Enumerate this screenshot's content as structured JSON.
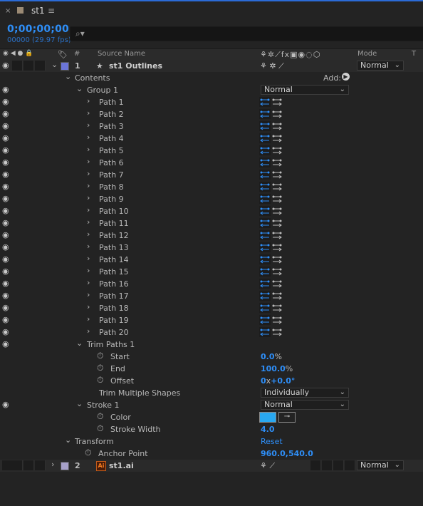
{
  "tab": {
    "title": "st1",
    "close_icon": "×",
    "menu_icon": "≡"
  },
  "timecode": "0;00;00;00",
  "frames": "00000 (29.97 fps)",
  "search": {
    "icon": "⌕▾",
    "placeholder": ""
  },
  "header": {
    "hash": "#",
    "tag_icon": "🏷",
    "source_name": "Source Name",
    "mode": "Mode",
    "t": "T",
    "switch_glyphs": "⚘✲⟋fx▣◉◌⬡",
    "vis_glyphs": "◉ ◀ ● 🔒"
  },
  "layer1": {
    "num": "1",
    "star": "★",
    "name": "st1 Outlines",
    "color": "#6b75d8",
    "mode": "Normal",
    "switches": "⚘ ✲ ⟋"
  },
  "contents": {
    "label": "Contents",
    "add_label": "Add:",
    "add_icon": "▶"
  },
  "group1": {
    "label": "Group 1",
    "blend": "Normal"
  },
  "paths": [
    "Path 1",
    "Path 2",
    "Path 3",
    "Path 4",
    "Path 5",
    "Path 6",
    "Path 7",
    "Path 8",
    "Path 9",
    "Path 10",
    "Path 11",
    "Path 12",
    "Path 13",
    "Path 14",
    "Path 15",
    "Path 16",
    "Path 17",
    "Path 18",
    "Path 19",
    "Path 20"
  ],
  "trim": {
    "label": "Trim Paths 1",
    "start_label": "Start",
    "start_value": "0.0",
    "start_unit": "%",
    "end_label": "End",
    "end_value": "100.0",
    "end_unit": "%",
    "offset_label": "Offset",
    "offset_value_a": "0",
    "offset_x": "x",
    "offset_value_b": "+0.0°",
    "multi_label": "Trim Multiple Shapes",
    "multi_value": "Individually"
  },
  "stroke": {
    "label": "Stroke 1",
    "blend": "Normal",
    "color_label": "Color",
    "color_value": "#29a8f0",
    "width_label": "Stroke Width",
    "width_value": "4.0"
  },
  "transform": {
    "label": "Transform",
    "reset": "Reset",
    "anchor_label": "Anchor Point",
    "anchor_value": "960.0,540.0"
  },
  "layer2": {
    "num": "2",
    "name": "st1.ai",
    "color": "#a7a1c9",
    "mode": "Normal",
    "switches": "⚘ ⟋"
  }
}
